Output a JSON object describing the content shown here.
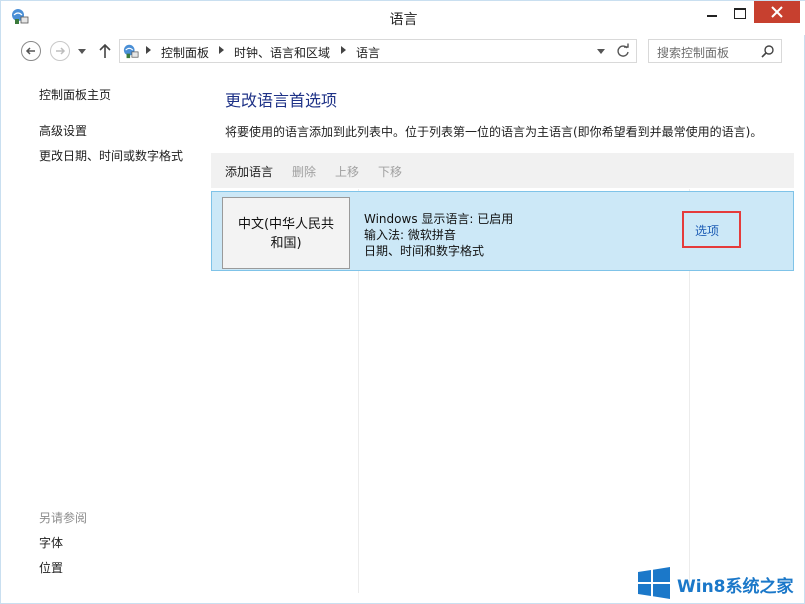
{
  "window": {
    "title": "语言",
    "app_icon": "control-panel-icon"
  },
  "address_bar": {
    "breadcrumbs": [
      "控制面板",
      "时钟、语言和区域",
      "语言"
    ],
    "search_placeholder": "搜索控制面板"
  },
  "sidebar": {
    "home_label": "控制面板主页",
    "links": [
      "高级设置",
      "更改日期、时间或数字格式"
    ],
    "see_also_label": "另请参阅",
    "see_also_links": [
      "字体",
      "位置"
    ]
  },
  "main": {
    "title": "更改语言首选项",
    "description": "将要使用的语言添加到此列表中。位于列表第一位的语言为主语言(即你希望看到并最常使用的语言)。",
    "toolbar": {
      "add": "添加语言",
      "remove": "删除",
      "move_up": "上移",
      "move_down": "下移"
    },
    "languages": [
      {
        "name_line1": "中文(中华人民共",
        "name_line2": "和国)",
        "details": [
          "Windows 显示语言: 已启用",
          "输入法: 微软拼音",
          "日期、时间和数字格式"
        ],
        "options_label": "选项"
      }
    ]
  },
  "watermark": {
    "text": "Win8系统之家"
  },
  "colors": {
    "accent_title": "#1e3287",
    "selected_row": "#cce8f7",
    "selected_border": "#7fc3e8",
    "highlight_box": "#e53b3b",
    "link": "#1d5db5",
    "close_button": "#c7402f"
  }
}
